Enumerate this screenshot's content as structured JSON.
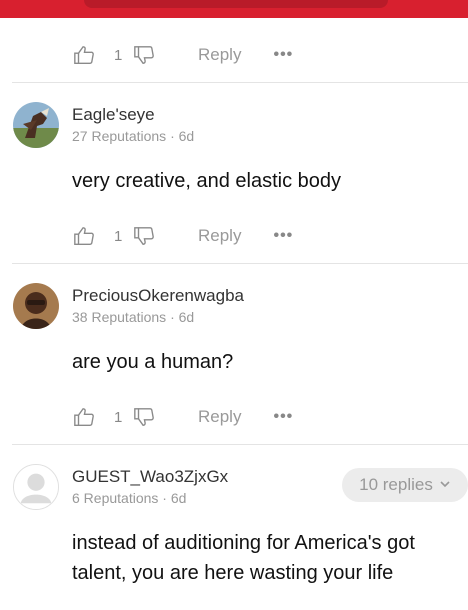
{
  "actions": {
    "like_count": "1",
    "reply_label": "Reply",
    "more_label": "•••"
  },
  "comments": [
    {
      "username": "Eagle'seye",
      "reputation": "27 Reputations",
      "age": "6d",
      "text": "very creative, and elastic body"
    },
    {
      "username": "PreciousOkerenwagba",
      "reputation": "38 Reputations",
      "age": "6d",
      "text": "are you a human?"
    },
    {
      "username": "GUEST_Wao3ZjxGx",
      "reputation": "6 Reputations",
      "age": "6d",
      "text": "instead of auditioning for America's got talent, you are here wasting your life",
      "replies_label": "10 replies"
    }
  ],
  "colors": {
    "brand_red": "#d8202f",
    "muted_text": "#999999",
    "divider": "#e4e4e4"
  }
}
